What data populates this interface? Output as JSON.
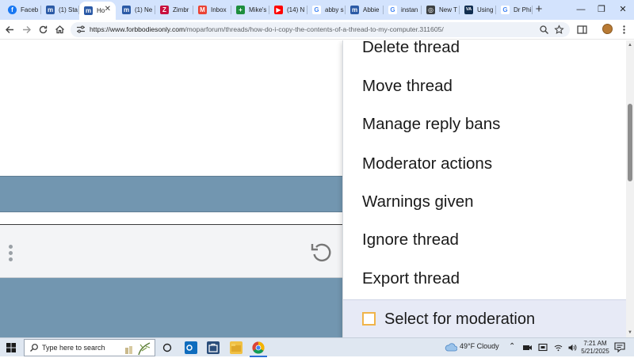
{
  "browser": {
    "tabs": [
      {
        "label": "Faceb",
        "icon": "facebook-icon",
        "color": "#1877f2",
        "glyph": "f"
      },
      {
        "label": "(1) Sta",
        "icon": "forum-logo-icon",
        "color": "#2b5aa6",
        "glyph": "m"
      },
      {
        "label": "Ho",
        "icon": "forum-logo-icon",
        "color": "#2b5aa6",
        "glyph": "m",
        "active": true
      },
      {
        "label": "(1) Ne",
        "icon": "forum-logo-icon",
        "color": "#2b5aa6",
        "glyph": "m"
      },
      {
        "label": "Zimbr",
        "icon": "zimbra-icon",
        "color": "#c8103e",
        "glyph": "Z"
      },
      {
        "label": "Inbox",
        "icon": "gmail-icon",
        "color": "#ea4335",
        "glyph": "M"
      },
      {
        "label": "Mike's",
        "icon": "sheets-icon",
        "color": "#1e8e3e",
        "glyph": "+"
      },
      {
        "label": "(14) N",
        "icon": "youtube-icon",
        "color": "#ff0000",
        "glyph": "▶"
      },
      {
        "label": "abby s",
        "icon": "google-icon",
        "color": "#ffffff",
        "glyph": "G"
      },
      {
        "label": "Abbie",
        "icon": "forum-logo-icon",
        "color": "#2b5aa6",
        "glyph": "m"
      },
      {
        "label": "instan",
        "icon": "google-icon",
        "color": "#ffffff",
        "glyph": "G"
      },
      {
        "label": "New T",
        "icon": "chrome-newtab-icon",
        "color": "#3c4043",
        "glyph": "◎"
      },
      {
        "label": "Using",
        "icon": "va-icon",
        "color": "#112e51",
        "glyph": "VA"
      },
      {
        "label": "Dr Phi",
        "icon": "google-icon",
        "color": "#ffffff",
        "glyph": "G"
      }
    ],
    "close_tab_glyph": "✕",
    "new_tab_glyph": "+",
    "window_controls": {
      "minimize": "—",
      "restore": "❐",
      "close": "✕"
    },
    "url_host": "https://www.forbbodiesonly.com",
    "url_path": "/moparforum/threads/how-do-i-copy-the-contents-of-a-thread-to-my-computer.311605/"
  },
  "menu": {
    "items": [
      "Delete thread",
      "Move thread",
      "Manage reply bans",
      "Moderator actions",
      "Warnings given",
      "Ignore thread",
      "Export thread"
    ],
    "footer_checkbox_label": "Select for moderation",
    "checkbox_color": "#f0b44a"
  },
  "page": {
    "band_color": "#7296b0"
  },
  "taskbar": {
    "search_placeholder": "Type here to search",
    "weather": "49°F  Cloudy",
    "time": "7:21 AM",
    "date": "5/21/2025"
  }
}
